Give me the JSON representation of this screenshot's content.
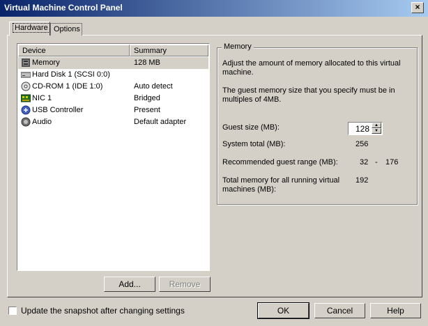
{
  "window": {
    "title": "Virtual Machine Control Panel",
    "close_glyph": "×"
  },
  "tabs": [
    {
      "label": "Hardware",
      "active": true
    },
    {
      "label": "Options",
      "active": false
    }
  ],
  "device_list": {
    "columns": [
      "Device",
      "Summary"
    ],
    "rows": [
      {
        "device": "Memory",
        "summary": "128 MB",
        "icon": "memory-icon",
        "selected": true
      },
      {
        "device": "Hard Disk 1 (SCSI 0:0)",
        "summary": "",
        "icon": "hard-disk-icon"
      },
      {
        "device": "CD-ROM 1 (IDE 1:0)",
        "summary": "Auto detect",
        "icon": "cdrom-icon"
      },
      {
        "device": "NIC 1",
        "summary": "Bridged",
        "icon": "nic-icon"
      },
      {
        "device": "USB Controller",
        "summary": "Present",
        "icon": "usb-icon"
      },
      {
        "device": "Audio",
        "summary": "Default adapter",
        "icon": "audio-icon"
      }
    ]
  },
  "buttons": {
    "add": "Add...",
    "remove": "Remove",
    "ok": "OK",
    "cancel": "Cancel",
    "help": "Help"
  },
  "memory_panel": {
    "group_label": "Memory",
    "description_1": "Adjust the amount of memory allocated to this virtual machine.",
    "description_2": "The guest memory size that you specify must be in multiples of 4MB.",
    "guest_size_label": "Guest size (MB):",
    "guest_size_value": "128",
    "system_total_label": "System total (MB):",
    "system_total_value": "256",
    "recommended_label": "Recommended guest range (MB):",
    "recommended_min": "32",
    "recommended_sep": "-",
    "recommended_max": "176",
    "total_running_label": "Total memory for all running virtual machines (MB):",
    "total_running_value": "192"
  },
  "snapshot_checkbox": {
    "label": "Update the snapshot after changing settings",
    "checked": false
  },
  "colors": {
    "title_start": "#0a246a",
    "title_end": "#a6caf0",
    "face": "#d4d0c8"
  }
}
